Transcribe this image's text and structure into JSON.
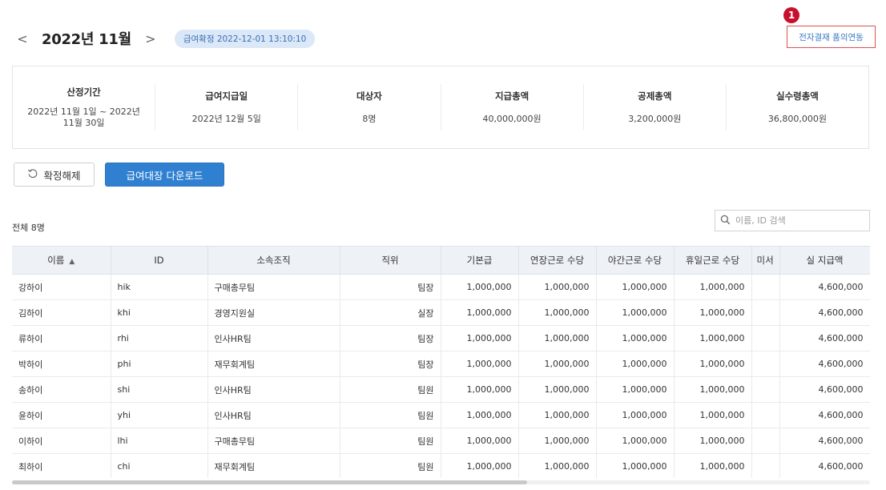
{
  "header": {
    "prev_label": "<",
    "next_label": ">",
    "title": "2022년 11월",
    "badge": "급여확정 2022-12-01 13:10:10"
  },
  "marker": "1",
  "approval_link": "전자결재 품의연동",
  "summary": [
    {
      "label": "산정기간",
      "value": "2022년 11월 1일 ~ 2022년 11월 30일"
    },
    {
      "label": "급여지급일",
      "value": "2022년 12월 5일"
    },
    {
      "label": "대상자",
      "value": "8명"
    },
    {
      "label": "지급총액",
      "value": "40,000,000원"
    },
    {
      "label": "공제총액",
      "value": "3,200,000원"
    },
    {
      "label": "실수령총액",
      "value": "36,800,000원"
    }
  ],
  "actions": {
    "undo_label": "확정해제",
    "download_label": "급여대장 다운로드"
  },
  "total_count": "전체 8명",
  "search": {
    "placeholder": "이름, ID 검색"
  },
  "table": {
    "headers": [
      "이름",
      "ID",
      "소속조직",
      "직위",
      "기본급",
      "연장근로 수당",
      "야간근로 수당",
      "휴일근로 수당",
      "미서",
      "실 지급액"
    ],
    "sort_indicator": "▲",
    "rows": [
      [
        "강하이",
        "hik",
        "구매총무팀",
        "팀장",
        "1,000,000",
        "1,000,000",
        "1,000,000",
        "1,000,000",
        "",
        "4,600,000"
      ],
      [
        "김하이",
        "khi",
        "경영지원실",
        "실장",
        "1,000,000",
        "1,000,000",
        "1,000,000",
        "1,000,000",
        "",
        "4,600,000"
      ],
      [
        "류하이",
        "rhi",
        "인사HR팀",
        "팀장",
        "1,000,000",
        "1,000,000",
        "1,000,000",
        "1,000,000",
        "",
        "4,600,000"
      ],
      [
        "박하이",
        "phi",
        "재무회계팀",
        "팀장",
        "1,000,000",
        "1,000,000",
        "1,000,000",
        "1,000,000",
        "",
        "4,600,000"
      ],
      [
        "송하이",
        "shi",
        "인사HR팀",
        "팀원",
        "1,000,000",
        "1,000,000",
        "1,000,000",
        "1,000,000",
        "",
        "4,600,000"
      ],
      [
        "윤하이",
        "yhi",
        "인사HR팀",
        "팀원",
        "1,000,000",
        "1,000,000",
        "1,000,000",
        "1,000,000",
        "",
        "4,600,000"
      ],
      [
        "이하이",
        "lhi",
        "구매총무팀",
        "팀원",
        "1,000,000",
        "1,000,000",
        "1,000,000",
        "1,000,000",
        "",
        "4,600,000"
      ],
      [
        "최하이",
        "chi",
        "재무회계팀",
        "팀원",
        "1,000,000",
        "1,000,000",
        "1,000,000",
        "1,000,000",
        "",
        "4,600,000"
      ]
    ]
  },
  "colors": {
    "primary": "#2f80d1",
    "badge_bg": "#dbe8f7",
    "marker": "#c8102e",
    "highlight_border": "#d9534f"
  }
}
